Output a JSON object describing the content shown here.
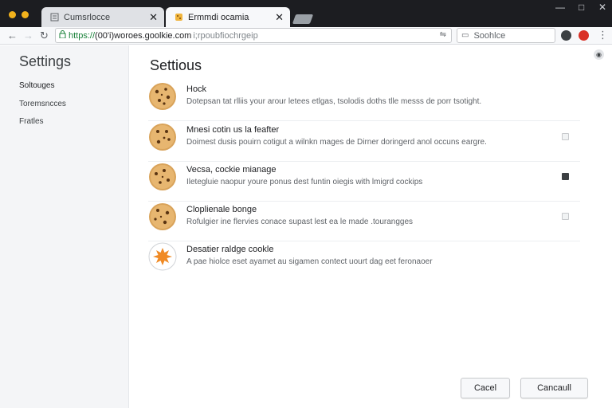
{
  "window": {
    "tabs": [
      {
        "label": "Cumsrlocce",
        "icon": "page-icon"
      },
      {
        "label": "Ermmdi ocamia",
        "icon": "cookie-icon"
      }
    ],
    "controls": {
      "minimize": "—",
      "maximize": "□",
      "close": "✕"
    }
  },
  "toolbar": {
    "url_scheme": "https://",
    "url_host": "(00'i)woroes.goolkie.com",
    "url_path": "i;rpoubfiochrgeip",
    "search_placeholder": "Soohlce",
    "colors": {
      "scheme": "#188038",
      "ext_red": "#d93025"
    }
  },
  "sidebar": {
    "title": "Settings",
    "items": [
      {
        "label": "Soltouges",
        "active": true
      },
      {
        "label": "Toremsncces",
        "active": false
      },
      {
        "label": "Fratles",
        "active": false
      }
    ]
  },
  "main": {
    "title": "Settious",
    "rows": [
      {
        "title": "Hock",
        "description": "Dotepsan tat rlliis your arour letees etlgas, tsolodis doths tlle messs de porr tsotight.",
        "checkbox": null
      },
      {
        "title": "Mnesi cotin us la feafter",
        "description": "Doimest dusis pouirn cotigut a wilnkn mages de Dirner doringerd anol occuns eargre.",
        "checkbox": false
      },
      {
        "title": "Vecsa, cockie mianage",
        "description": "Iletegluie naopur youre ponus dest funtin oiegis with lmigrd cockips",
        "checkbox": true
      },
      {
        "title": "Cloplienale bonge",
        "description": "Rofulgier ine flervies conace supast lest ea le made .tourangges",
        "checkbox": false
      },
      {
        "title": "Desatier raldge cookle",
        "description": "A pae hiolce eset ayamet au sigamen contect uourt dag eet feronaoer",
        "checkbox": null
      }
    ]
  },
  "footer": {
    "cancel_label": "Cacel",
    "cancel2_label": "Cancaull"
  }
}
